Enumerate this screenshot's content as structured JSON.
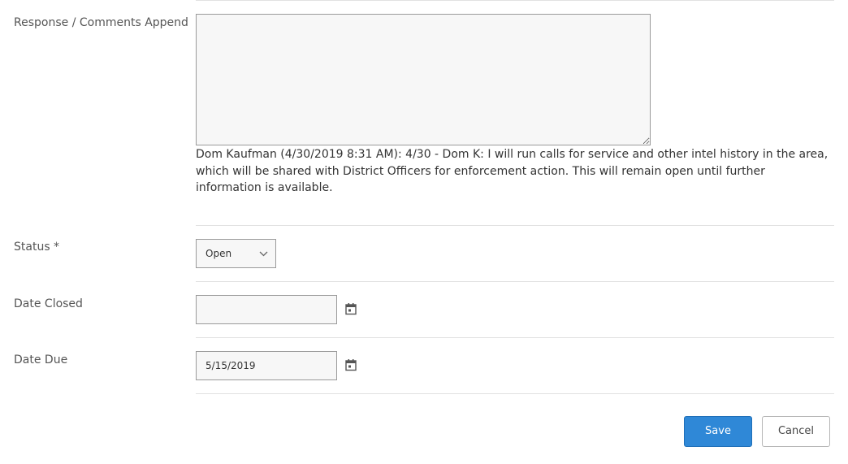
{
  "form": {
    "response_label": "Response / Comments Append",
    "response_value": "",
    "existing_comment": "Dom Kaufman (4/30/2019 8:31 AM): 4/30 - Dom K: I will run calls for service and other intel history in the area, which will be shared with District Officers for enforcement action. This will remain open until further information is available.",
    "status_label": "Status *",
    "status_value": "Open",
    "date_closed_label": "Date Closed",
    "date_closed_value": "",
    "date_due_label": "Date Due",
    "date_due_value": "5/15/2019"
  },
  "buttons": {
    "save_label": "Save",
    "cancel_label": "Cancel"
  },
  "icons": {
    "status_dropdown": "chevron-down-icon",
    "date_closed_picker": "calendar-icon",
    "date_due_picker": "calendar-icon"
  },
  "colors": {
    "primary": "#2f88d7",
    "field_background": "#f7f7f7",
    "divider": "#e2e2e2"
  }
}
